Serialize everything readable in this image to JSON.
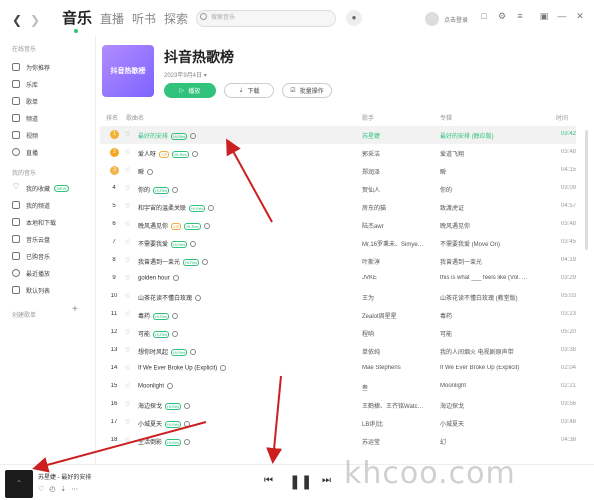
{
  "top": {
    "tabs": [
      "音乐",
      "直播",
      "听书",
      "探索"
    ],
    "search_placeholder": "搜索音乐",
    "login_text": "点击登录"
  },
  "sidebar": {
    "online_title": "在线音乐",
    "online_items": [
      "为你推荐",
      "乐库",
      "歌单",
      "频道",
      "视频",
      "直播"
    ],
    "my_title": "我的音乐",
    "my_items": [
      "我的收藏",
      "我的频道",
      "本地和下载",
      "音乐云盘",
      "已购音乐",
      "最近播放",
      "默认列表"
    ],
    "fav_badge": "NEW",
    "created_title": "创建歌单"
  },
  "playlist": {
    "cover_text": "抖音热歌榜",
    "title": "抖音热歌榜",
    "date": "2023年9月4日",
    "play_label": "播放",
    "download_label": "下载",
    "batch_label": "批量操作"
  },
  "table": {
    "headers": {
      "rank": "排名",
      "song": "歌曲名",
      "artist": "歌手",
      "album": "专辑",
      "time": "时间"
    },
    "rows": [
      {
        "n": "1",
        "name": "最好的安排",
        "tags": [
          "Hi-Res"
        ],
        "artist": "苏星婕",
        "album": "最好的安排 (醇应版)",
        "time": "03:42"
      },
      {
        "n": "2",
        "name": "爱人呀",
        "tags": [
          "VIP",
          "Hi-Res"
        ],
        "artist": "郭采洁",
        "album": "爱道飞翔",
        "time": "03:48"
      },
      {
        "n": "3",
        "name": "瞬",
        "tags": [],
        "artist": "郑润泽",
        "album": "瞬",
        "time": "04:15"
      },
      {
        "n": "4",
        "name": "你的",
        "tags": [
          "Hi-Res"
        ],
        "artist": "贺仙人",
        "album": "你的",
        "time": "03:09"
      },
      {
        "n": "5",
        "name": "和宇宙的温柔关联",
        "tags": [
          "Hi-Res"
        ],
        "artist": "房东的猫",
        "album": "致渡虎证",
        "time": "04:57"
      },
      {
        "n": "6",
        "name": "晚风遇见你",
        "tags": [
          "VIP",
          "Hi-Res"
        ],
        "artist": "陆杰awr",
        "album": "晚风遇见你",
        "time": "03:48"
      },
      {
        "n": "7",
        "name": "不需要我爱",
        "tags": [
          "Hi-Res"
        ],
        "artist": "Mr.16罗秉未、Simye…",
        "album": "不需要我爱 (Move On)",
        "time": "03:45"
      },
      {
        "n": "8",
        "name": "我曾遇到一束光",
        "tags": [
          "Hi-Res"
        ],
        "artist": "叶斯淳",
        "album": "我曾遇到一束光",
        "time": "04:19"
      },
      {
        "n": "9",
        "name": "golden hour",
        "tags": [],
        "artist": "JVKE",
        "album": "this is what ___ feels like (Vol. …",
        "time": "03:29"
      },
      {
        "n": "10",
        "name": "山茶花读不懂白玫瑰",
        "tags": [],
        "artist": "王为",
        "album": "山茶花读不懂白玫瑰 (教堂版)",
        "time": "05:03"
      },
      {
        "n": "11",
        "name": "毒药",
        "tags": [
          "Hi-Res"
        ],
        "artist": "Zealot周星星",
        "album": "毒药",
        "time": "03:23"
      },
      {
        "n": "12",
        "name": "可能",
        "tags": [
          "Hi-Res"
        ],
        "artist": "程响",
        "album": "可能",
        "time": "05:20"
      },
      {
        "n": "13",
        "name": "想你时风起",
        "tags": [
          "Hi-Res"
        ],
        "artist": "单依纯",
        "album": "我的人间烟火 电视剧原声带",
        "time": "03:38"
      },
      {
        "n": "14",
        "name": "If We Ever Broke Up (Explicit)",
        "tags": [],
        "artist": "Mae Stephens",
        "album": "If We Ever Broke Up (Explicit)",
        "time": "02:04"
      },
      {
        "n": "15",
        "name": "Moonlight",
        "tags": [],
        "artist": "叁",
        "album": "Moonlight",
        "time": "02:21"
      },
      {
        "n": "16",
        "name": "海边探戈",
        "tags": [
          "Hi-Res"
        ],
        "artist": "王鹤棣、王齐铭Watc…",
        "album": "海边探戈",
        "time": "03:56"
      },
      {
        "n": "17",
        "name": "小城夏天",
        "tags": [
          "Hi-Res"
        ],
        "artist": "LBI利比",
        "album": "小城夏天",
        "time": "03:48"
      },
      {
        "n": "18",
        "name": "生活倒影",
        "tags": [
          "Hi-Res"
        ],
        "artist": "苏运莹",
        "album": "幻",
        "time": "04:38"
      }
    ]
  },
  "player": {
    "now_playing": "苏星婕 - 最好的安排"
  },
  "watermark": "khcoo.com",
  "colors": {
    "accent": "#31c27c",
    "top1": "#f2b134",
    "top2": "#f5a623",
    "top3": "#f0b448",
    "vip": "#e5b23a",
    "arrow": "#cc1f1f"
  }
}
